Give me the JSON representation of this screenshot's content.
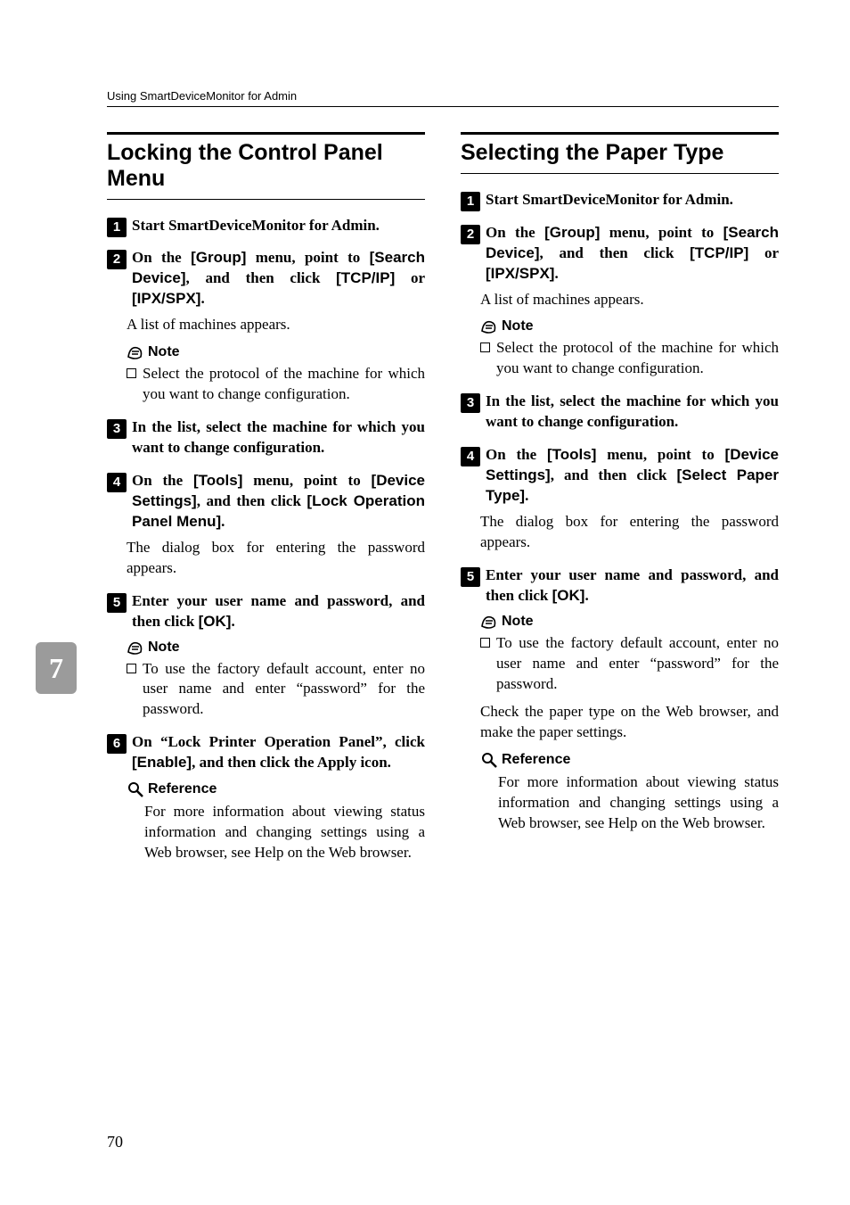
{
  "header": "Using SmartDeviceMonitor for Admin",
  "tab": "7",
  "page_num": "70",
  "left": {
    "title": "Locking the Control Panel Menu",
    "s1": {
      "pre": "Start SmartDeviceMonitor for Admin."
    },
    "s2": {
      "pre": "On the ",
      "u1": "[Group]",
      "mid1": " menu, point to ",
      "u2": "[Search Device]",
      "mid2": ", and then click ",
      "u3": "[TCP/IP]",
      "mid3": " or ",
      "u4": "[IPX/SPX]",
      "post": "."
    },
    "s2_body": "A list of machines appears.",
    "note": "Note",
    "s2_note": "Select the protocol of the machine for which you want to change configuration.",
    "s3": "In the list, select the machine for which you want to change configuration.",
    "s4": {
      "pre": "On the ",
      "u1": "[Tools]",
      "mid1": " menu, point to ",
      "u2": "[Device Settings]",
      "mid2": ", and then click ",
      "u3": "[Lock Operation Panel Menu]",
      "post": "."
    },
    "s4_body": "The dialog box for entering the password appears.",
    "s5": {
      "pre": "Enter your user name and password, and then click ",
      "u1": "[OK]",
      "post": "."
    },
    "s5_note": "To use the factory default account, enter no user name and enter “password” for the password.",
    "s6": {
      "pre": "On “Lock Printer Operation Panel”, click ",
      "u1": "[Enable]",
      "post": ", and then click the Apply icon."
    },
    "ref": "Reference",
    "ref_text": "For more information about viewing status information and changing settings using a Web browser, see Help on the Web browser."
  },
  "right": {
    "title": "Selecting the Paper Type",
    "s1": {
      "pre": "Start SmartDeviceMonitor for Admin."
    },
    "s2": {
      "pre": "On the ",
      "u1": "[Group]",
      "mid1": " menu, point to ",
      "u2": "[Search Device]",
      "mid2": ", and then click ",
      "u3": "[TCP/IP]",
      "mid3": " or ",
      "u4": "[IPX/SPX]",
      "post": "."
    },
    "s2_body": "A list of machines appears.",
    "note": "Note",
    "s2_note": "Select the protocol of the machine for which you want to change configuration.",
    "s3": "In the list, select the machine for which you want to change configuration.",
    "s4": {
      "pre": "On the ",
      "u1": "[Tools]",
      "mid1": " menu, point to ",
      "u2": "[Device Settings]",
      "mid2": ", and then click ",
      "u3": "[Select Paper Type]",
      "post": "."
    },
    "s4_body": "The dialog box for entering the password appears.",
    "s5": {
      "pre": "Enter your user name and password, and then click ",
      "u1": "[OK]",
      "post": "."
    },
    "s5_note": "To use the factory default account, enter no user name and enter “password” for the password.",
    "s5_extra": "Check the paper type on the Web browser, and make the paper settings.",
    "ref": "Reference",
    "ref_text": "For more information about viewing status information and changing settings using a Web browser, see Help on the Web browser."
  }
}
